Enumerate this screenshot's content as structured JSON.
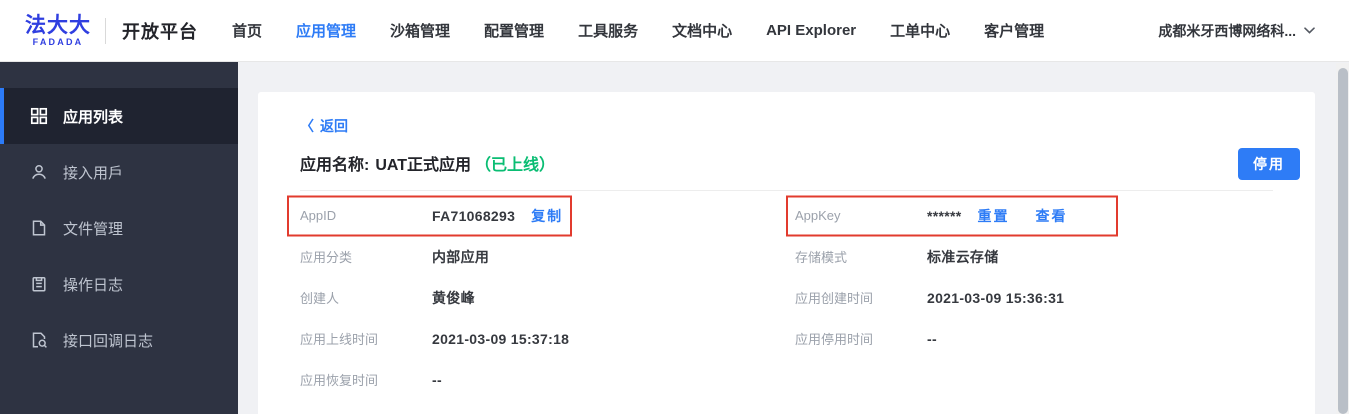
{
  "brand": {
    "logo_cn": "法大大",
    "logo_en": "FADADA",
    "platform_title": "开放平台"
  },
  "nav": {
    "items": [
      {
        "label": "首页",
        "active": false
      },
      {
        "label": "应用管理",
        "active": true
      },
      {
        "label": "沙箱管理",
        "active": false
      },
      {
        "label": "配置管理",
        "active": false
      },
      {
        "label": "工具服务",
        "active": false
      },
      {
        "label": "文档中心",
        "active": false
      },
      {
        "label": "API Explorer",
        "active": false
      },
      {
        "label": "工单中心",
        "active": false
      },
      {
        "label": "客户管理",
        "active": false
      }
    ],
    "account_name": "成都米牙西博网络科..."
  },
  "sidebar": {
    "items": [
      {
        "icon": "grid-icon",
        "label": "应用列表",
        "active": true
      },
      {
        "icon": "user-icon",
        "label": "接入用戶",
        "active": false
      },
      {
        "icon": "file-icon",
        "label": "文件管理",
        "active": false
      },
      {
        "icon": "clipboard-icon",
        "label": "操作日志",
        "active": false
      },
      {
        "icon": "doc-search-icon",
        "label": "接口回调日志",
        "active": false
      }
    ]
  },
  "main": {
    "back_chevron": "〈",
    "back_label": "返回",
    "app_name_label": "应用名称:",
    "app_name": "UAT正式应用",
    "status": "（已上线）",
    "stop_button": "停用",
    "fields": [
      {
        "label": "AppID",
        "value": "FA71068293",
        "links": [
          "复制"
        ],
        "annotated": true
      },
      {
        "label": "AppKey",
        "value": "******",
        "links": [
          "重置",
          "查看"
        ],
        "annotated": true
      },
      {
        "label": "应用分类",
        "value": "内部应用"
      },
      {
        "label": "存储模式",
        "value": "标准云存储"
      },
      {
        "label": "创建人",
        "value": "黄俊峰"
      },
      {
        "label": "应用创建时间",
        "value": "2021-03-09 15:36:31"
      },
      {
        "label": "应用上线时间",
        "value": "2021-03-09 15:37:18"
      },
      {
        "label": "应用停用时间",
        "value": "--"
      },
      {
        "label": "应用恢复时间",
        "value": "--"
      }
    ]
  },
  "colors": {
    "accent_blue": "#2e7cf6",
    "brand_blue": "#2f3ee0",
    "status_green": "#0abd73",
    "annotation_red": "#e23b2e",
    "sidebar_bg": "#2e3342",
    "sidebar_active_bg": "#1f2330"
  }
}
